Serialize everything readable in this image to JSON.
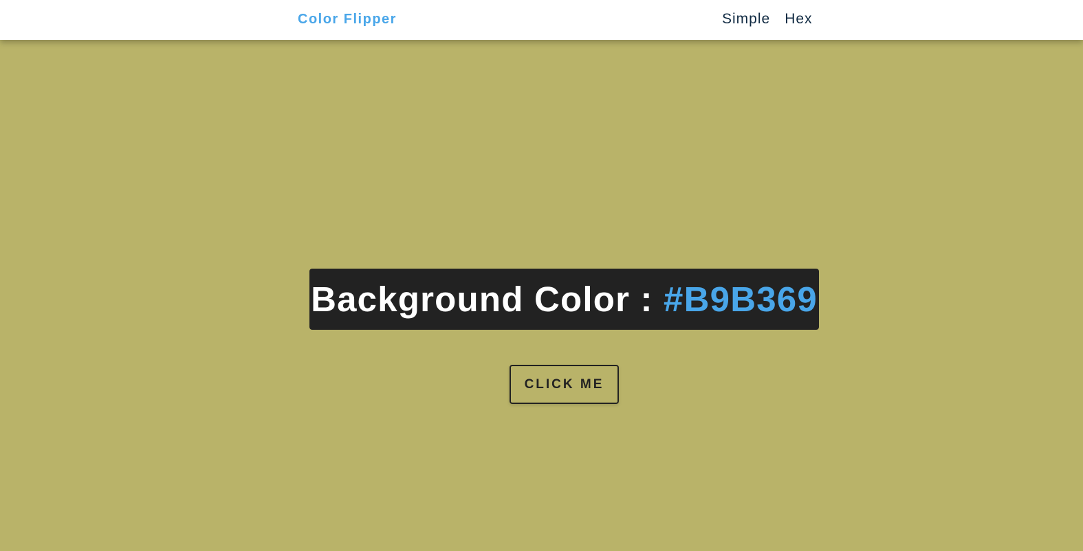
{
  "navbar": {
    "brand": "Color Flipper",
    "links": [
      {
        "label": "Simple"
      },
      {
        "label": "Hex"
      }
    ]
  },
  "main": {
    "title_prefix": "Background Color : ",
    "color_value": "#B9B369",
    "button_label": "click me"
  },
  "colors": {
    "background": "#B9B369",
    "accent": "#49A6E9",
    "panel": "#222222",
    "nav_text": "#102A42"
  }
}
